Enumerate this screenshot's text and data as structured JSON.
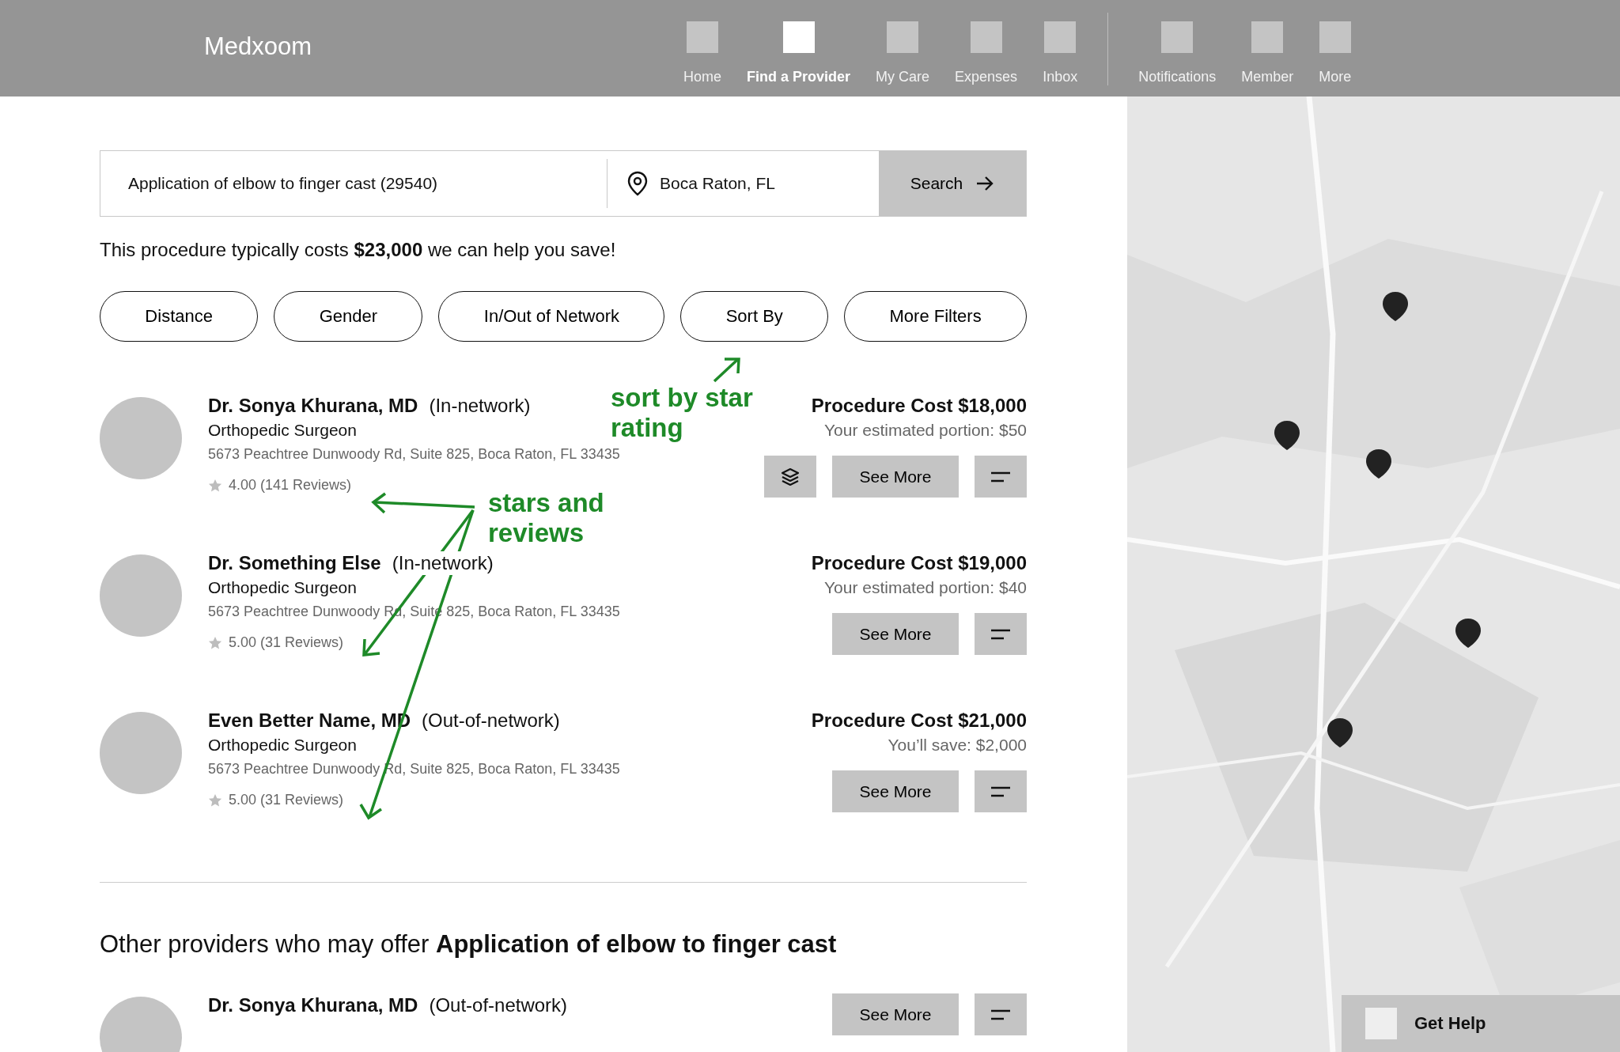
{
  "app": {
    "logo": "Medxoom"
  },
  "nav": [
    {
      "label": "Home",
      "selected": false
    },
    {
      "label": "Find a Provider",
      "selected": true
    },
    {
      "label": "My Care",
      "selected": false
    },
    {
      "label": "Expenses",
      "selected": false
    },
    {
      "label": "Inbox",
      "selected": false
    }
  ],
  "nav_secondary": [
    {
      "label": "Notifications",
      "selected": false
    },
    {
      "label": "Member",
      "selected": false
    },
    {
      "label": "More",
      "selected": false
    }
  ],
  "search": {
    "query": "Application of elbow to finger cast (29540)",
    "location": "Boca Raton, FL",
    "button": "Search"
  },
  "cost_note": "This procedure typically costs **$23,000** we can help you save!",
  "filters": [
    "Distance",
    "Gender",
    "In/Out of Network",
    "Sort By",
    "More Filters"
  ],
  "providers": [
    {
      "name": "Dr. Sonya Khurana, MD",
      "network": "(In-network)",
      "specialty": "Orthopedic Surgeon",
      "address": "5673 Peachtree Dunwoody Rd, Suite 825, Boca Raton, FL 33435",
      "rating": "4.00 (141 Reviews)",
      "cost": "Procedure Cost $18,000",
      "portion": "Your estimated portion: $50",
      "layers_button": true,
      "see_more": "See More"
    },
    {
      "name": "Dr. Something Else",
      "network": "(In-network)",
      "specialty": "Orthopedic Surgeon",
      "address": "5673 Peachtree Dunwoody Rd, Suite 825, Boca Raton, FL 33435",
      "rating": "5.00 (31 Reviews)",
      "cost": "Procedure Cost $19,000",
      "portion": "Your estimated portion: $40",
      "layers_button": false,
      "see_more": "See More"
    },
    {
      "name": "Even Better Name, MD",
      "network": "(Out-of-network)",
      "specialty": "Orthopedic Surgeon",
      "address": "5673 Peachtree Dunwoody Rd, Suite 825, Boca Raton, FL 33435",
      "rating": "5.00 (31 Reviews)",
      "cost": "Procedure Cost $21,000",
      "portion": "You’ll save: $2,000",
      "layers_button": false,
      "see_more": "See More"
    }
  ],
  "other_section": {
    "heading": "Other providers who may offer **Application of elbow to finger cast**",
    "providers": [
      {
        "name": "Dr. Sonya Khurana, MD",
        "network": "(Out-of-network)",
        "see_more": "See More"
      }
    ]
  },
  "annotations": [
    "sort by star rating",
    "stars and reviews"
  ],
  "help": {
    "label": "Get Help"
  }
}
